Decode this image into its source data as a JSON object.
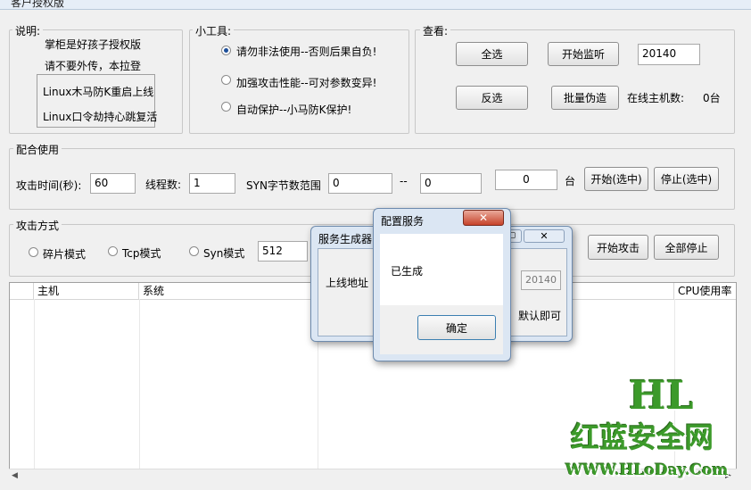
{
  "window": {
    "title": "客户授权版"
  },
  "info": {
    "legend": "说明:",
    "line1": "掌柜是好孩子授权版",
    "line2": "请不要外传，本拉登",
    "box_line1": "Linux木马防K重启上线",
    "box_line2": "Linux口令劫持心跳复活"
  },
  "tools": {
    "legend": "小工具:",
    "option1": "请勿非法使用--否则后果自负!",
    "option2": "加强攻击性能--可对参数变异!",
    "option3": "自动保护--小马防K保护!",
    "selected": "option1"
  },
  "view": {
    "legend": "查看:",
    "select_all": "全选",
    "start_listen": "开始监听",
    "port": "20140",
    "invert": "反选",
    "batch_fake": "批量伪造",
    "online_label": "在线主机数:",
    "online_count": "0台"
  },
  "combo": {
    "legend": "配合使用",
    "time_label": "攻击时间(秒):",
    "time_value": "60",
    "threads_label": "线程数:",
    "threads_value": "1",
    "syn_label": "SYN字节数范围",
    "syn_from": "0",
    "dash": "--",
    "syn_to": "0",
    "count_value": "0",
    "unit": "台",
    "start_selected": "开始(选中)",
    "stop_selected": "停止(选中)"
  },
  "attack": {
    "legend": "攻击方式",
    "mode1": "碎片模式",
    "mode2": "Tcp模式",
    "mode3": "Syn模式",
    "size_value": "512",
    "start_attack": "开始攻击",
    "stop_all": "全部停止"
  },
  "table": {
    "columns": [
      "主机",
      "系统",
      "CPU使用率"
    ]
  },
  "service_builder": {
    "title": "服务生成器",
    "online_address_label": "上线地址",
    "port_value": "20140",
    "default_hint": "默认即可"
  },
  "config_dialog": {
    "title": "配置服务",
    "message": "已生成",
    "ok": "确定"
  },
  "watermark": {
    "logo": "HL",
    "name": "红蓝安全网",
    "url": "WWW.HLoDay.Com"
  }
}
